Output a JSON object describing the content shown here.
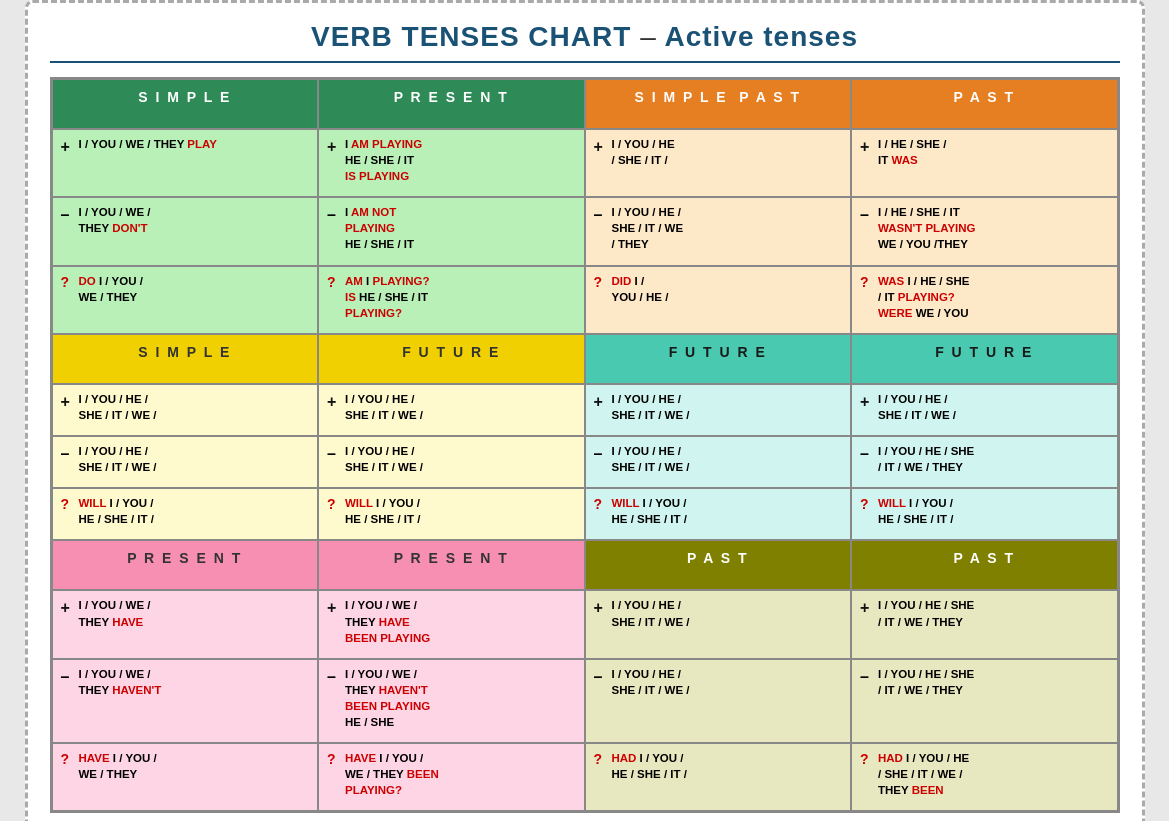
{
  "title": "VERB TENSES CHART – Active tenses",
  "sections": {
    "present": {
      "headers": [
        "SIMPLE",
        "PRESENT",
        "SIMPLE PAST",
        "PAST"
      ],
      "cells": [
        {
          "bg": "lightgreen",
          "entries": [
            {
              "sign": "+",
              "text": "I / YOU / WE / THEY ",
              "highlight": "PLAY",
              "color": "red"
            },
            {
              "sign": "–",
              "text": "I / YOU / WE / THEY ",
              "highlight": "DON'T",
              "color": "red"
            },
            {
              "sign": "?",
              "text": "",
              "highlight": "DO",
              "color": "red",
              "after": " I / YOU / WE / THEY"
            }
          ]
        },
        {
          "bg": "lightgreen",
          "entries": [
            {
              "sign": "+",
              "text": "I ",
              "highlight": "AM PLAYING",
              "color": "red",
              "newline": "HE / SHE / IT",
              "highlight2": "IS PLAYING",
              "color2": "red"
            },
            {
              "sign": "–",
              "text": "I ",
              "highlight": "AM NOT PLAYING",
              "color": "red",
              "after": " HE / SHE / IT"
            },
            {
              "sign": "?",
              "text": "",
              "highlight": "AM",
              "color": "red",
              "after": " I PLAYING? IS HE / SHE / IT PLAYING?"
            }
          ]
        },
        {
          "bg": "lightorange",
          "entries": [
            {
              "sign": "+",
              "text": "I / YOU / HE / SHE / IT /"
            },
            {
              "sign": "–",
              "text": "I / YOU / HE / SHE / IT / WE / THEY"
            },
            {
              "sign": "?",
              "text": "",
              "highlight": "DID",
              "color": "red",
              "after": " I / YOU / HE /"
            }
          ]
        },
        {
          "bg": "lightorange",
          "entries": [
            {
              "sign": "+",
              "text": "I / HE / SHE / IT ",
              "highlight": "WAS",
              "color": "red"
            },
            {
              "sign": "–",
              "text": "I / HE / SHE / IT ",
              "highlight": "WASN'T PLAYING",
              "color": "red",
              "after": " WE / YOU /THEY"
            },
            {
              "sign": "?",
              "text": "",
              "highlight": "WAS",
              "color": "red",
              "after": " I / HE / SHE / IT PLAYING? WERE WE / YOU"
            }
          ]
        }
      ]
    },
    "future": {
      "headers": [
        "SIMPLE",
        "FUTURE",
        "FUTURE",
        "FUTURE"
      ],
      "cells": [
        {
          "bg": "lightyellow",
          "entries": [
            {
              "sign": "+",
              "text": "I / YOU / HE / SHE / IT / WE /"
            },
            {
              "sign": "–",
              "text": "I / YOU / HE / SHE / IT / WE /"
            },
            {
              "sign": "?",
              "text": "",
              "highlight": "WILL",
              "color": "red",
              "after": " I / YOU / HE / SHE / IT /"
            }
          ]
        },
        {
          "bg": "lightyellow",
          "entries": [
            {
              "sign": "+",
              "text": "I / YOU / HE / SHE / IT / WE /"
            },
            {
              "sign": "–",
              "text": "I / YOU / HE / SHE / IT / WE /"
            },
            {
              "sign": "?",
              "text": "",
              "highlight": "WILL",
              "color": "red",
              "after": " I / YOU / HE / SHE / IT /"
            }
          ]
        },
        {
          "bg": "lightcyan",
          "entries": [
            {
              "sign": "+",
              "text": "I / YOU / HE / SHE / IT / WE /"
            },
            {
              "sign": "–",
              "text": "I / YOU / HE / SHE / IT / WE /"
            },
            {
              "sign": "?",
              "text": "",
              "highlight": "WILL",
              "color": "red",
              "after": " I / YOU / HE / SHE / IT /"
            }
          ]
        },
        {
          "bg": "lightcyan",
          "entries": [
            {
              "sign": "+",
              "text": "I / YOU / HE / SHE / IT / WE /"
            },
            {
              "sign": "–",
              "text": "I / YOU / HE / SHE / IT / WE /"
            },
            {
              "sign": "?",
              "text": "",
              "highlight": "WILL",
              "color": "red",
              "after": " I / YOU / HE / SHE / IT /"
            }
          ]
        }
      ]
    },
    "perfect": {
      "headers": [
        "PRESENT",
        "PRESENT",
        "PAST",
        "PAST"
      ],
      "cells": [
        {
          "bg": "lightpink",
          "entries": [
            {
              "sign": "+",
              "text": "I / YOU / WE / THEY ",
              "highlight": "HAVE",
              "color": "red"
            },
            {
              "sign": "–",
              "text": "I / YOU / WE / THEY ",
              "highlight": "HAVEN'T",
              "color": "red"
            },
            {
              "sign": "?",
              "text": "",
              "highlight": "HAVE",
              "color": "red",
              "after": " I / YOU / WE / THEY"
            }
          ]
        },
        {
          "bg": "lightpink",
          "entries": [
            {
              "sign": "+",
              "text": "I / YOU / WE / THEY ",
              "highlight": "HAVE BEEN PLAYING",
              "color": "red"
            },
            {
              "sign": "–",
              "text": "I / YOU / WE / THEY ",
              "highlight": "HAVEN'T BEEN PLAYING",
              "color": "red",
              "after": " HE / SHE"
            },
            {
              "sign": "?",
              "text": "",
              "highlight": "HAVE",
              "color": "red",
              "after": " I / YOU / WE / THEY BEEN PLAYING?"
            }
          ]
        },
        {
          "bg": "lightkhaki",
          "entries": [
            {
              "sign": "+",
              "text": "I / YOU / HE / SHE / IT / WE /"
            },
            {
              "sign": "–",
              "text": "I / YOU / HE / SHE / IT / WE /"
            },
            {
              "sign": "?",
              "text": "",
              "highlight": "HAD",
              "color": "red",
              "after": " I / YOU / HE / SHE / IT /"
            }
          ]
        },
        {
          "bg": "lightkhaki",
          "entries": [
            {
              "sign": "+",
              "text": "I / YOU / HE / SHE / IT / WE / THEY"
            },
            {
              "sign": "–",
              "text": "I / YOU / HE / SHE / IT / WE / THEY"
            },
            {
              "sign": "?",
              "text": "",
              "highlight": "HAD",
              "color": "red",
              "after": " I / YOU / HE / SHE / IT / WE / THEY BEEN"
            }
          ]
        }
      ]
    }
  }
}
